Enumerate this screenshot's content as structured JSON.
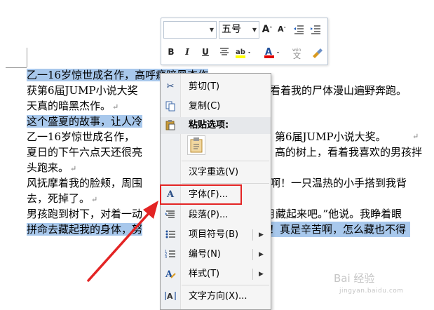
{
  "document": {
    "lines": [
      {
        "text": "乙一16岁惊世成名作，高呼瘾暗黑杰作",
        "selected": true
      },
      {
        "text": "获第6届JUMP小说大奖",
        "tail": "我看着我的尸体漫山遍野奔跑。",
        "selected": false
      },
      {
        "text": "天真的暗黑杰作。",
        "selected": false
      },
      {
        "text": "这个盛夏的故事，让人冷",
        "selected": true
      },
      {
        "text": " 乙一16岁惊世成名作，",
        "tail": "第6届JUMP小说大奖。",
        "selected": false
      },
      {
        "text": "夏日的下午六点天还很亮",
        "tail": "高的树上，看着我喜欢的男孩拌",
        "selected": false
      },
      {
        "text": "头跑来。",
        "selected": false
      },
      {
        "text": "风抚摩着我的脸颊，周围",
        "tail": "好啊！一只温热的小手搭到我背",
        "selected": false
      },
      {
        "text": "去，死掉了。",
        "selected": false
      },
      {
        "text": "男孩跑到树下，对着一动",
        "tail": "月藏起来吧。”他说。我睁着眼",
        "selected": false
      },
      {
        "text": "拼命去藏起我的身体，努",
        "tail": "！真是辛苦啊，怎么藏也不得",
        "selected": true
      }
    ],
    "paragraph_mark": "↵"
  },
  "mini_toolbar": {
    "font_name": "",
    "font_size": "五号",
    "buttons": [
      "grow-font",
      "shrink-font",
      "decrease-indent",
      "increase-indent",
      "bold",
      "italic",
      "underline",
      "center",
      "highlight",
      "font-color",
      "phonetic-guide",
      "format-painter"
    ],
    "bold_label": "B",
    "italic_label": "I",
    "underline_label": "U",
    "highlight_color": "#ffff00",
    "font_color": "#e00000"
  },
  "context_menu": {
    "items": [
      {
        "label": "剪切(T)",
        "icon": "scissors-icon"
      },
      {
        "label": "复制(C)",
        "icon": "copy-icon"
      },
      {
        "label": "粘贴选项:",
        "icon": "paste-icon"
      },
      {
        "label": "汉字重选(V)",
        "icon": ""
      },
      {
        "label": "字体(F)...",
        "icon": "font-icon"
      },
      {
        "label": "段落(P)...",
        "icon": "paragraph-icon"
      },
      {
        "label": "项目符号(B)",
        "icon": "bullets-icon"
      },
      {
        "label": "编号(N)",
        "icon": "numbering-icon"
      },
      {
        "label": "样式(T)",
        "icon": "styles-icon"
      },
      {
        "label": "文字方向(X)...",
        "icon": "text-direction-icon"
      }
    ]
  },
  "colors": {
    "selection": "#a8c8ec",
    "highlight_border": "#e32424"
  },
  "watermark": {
    "text": "Bai 经验",
    "sub": "jingyan.baidu.com"
  }
}
